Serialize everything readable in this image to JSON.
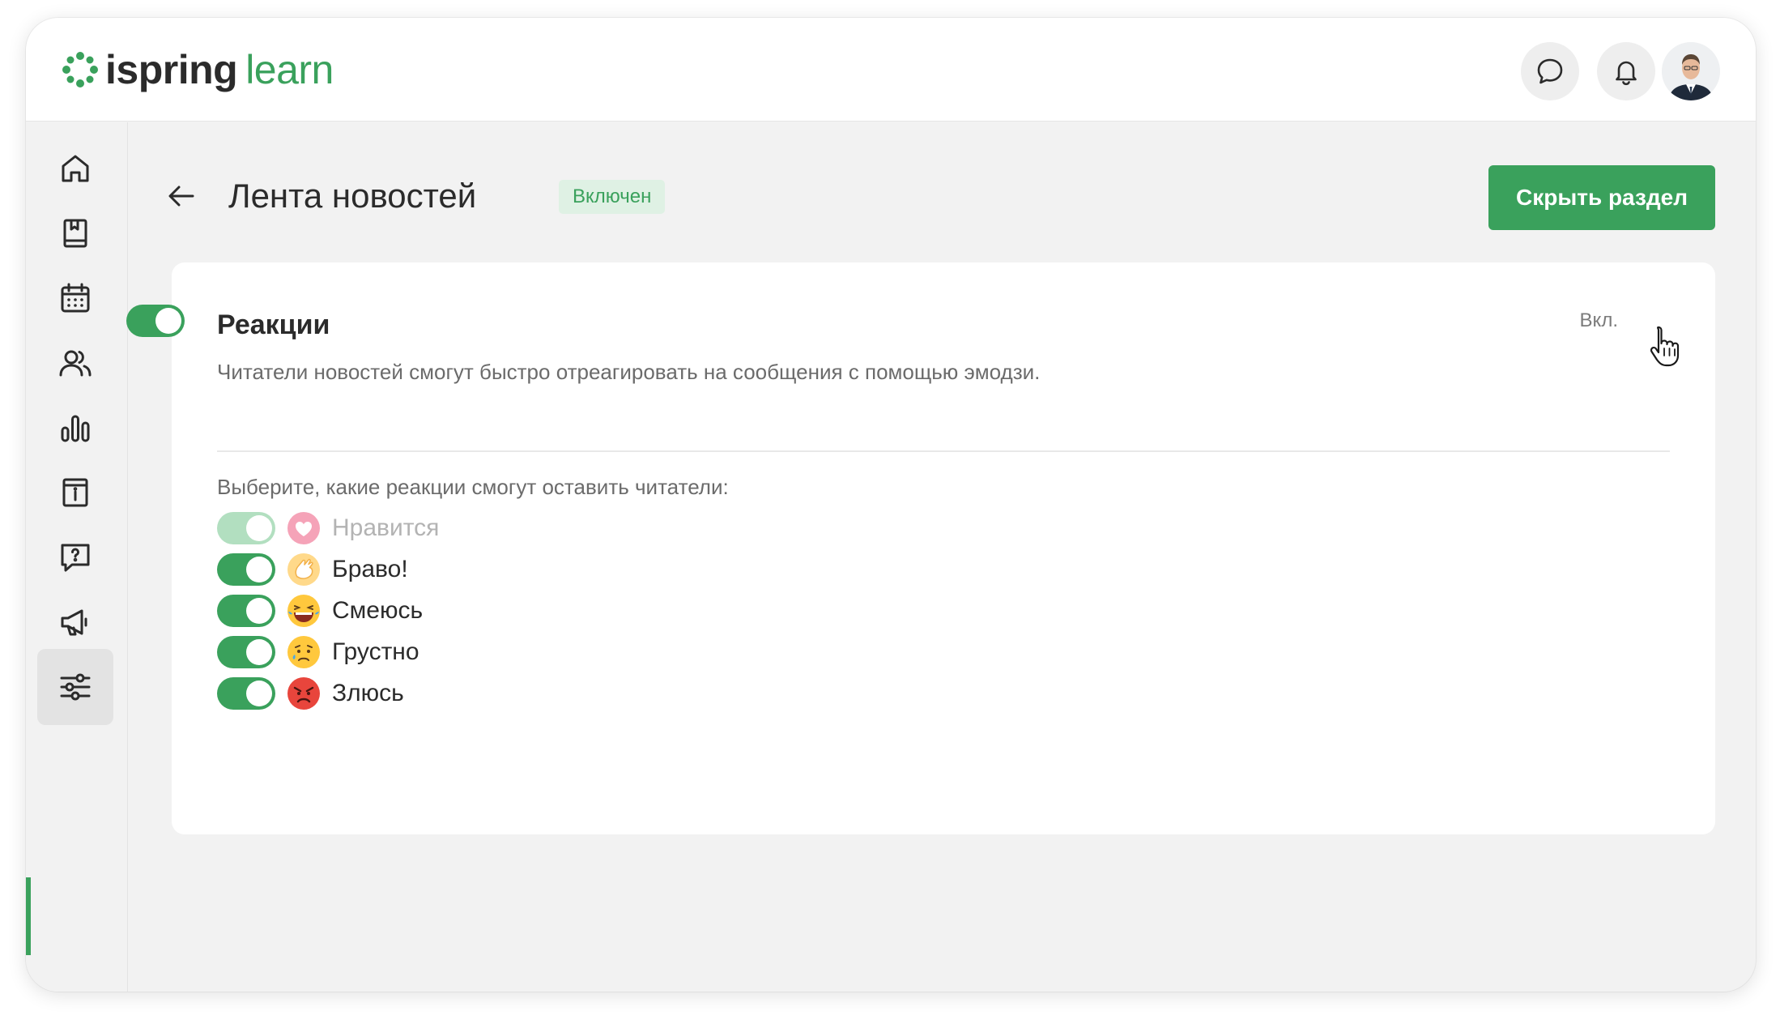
{
  "brand": {
    "name_part1": "ispring",
    "name_part2": "learn",
    "accent": "#3aa15c"
  },
  "header": {
    "icons": [
      "chat-icon",
      "bell-icon"
    ],
    "avatar": "user-avatar"
  },
  "sidebar": {
    "items": [
      {
        "icon": "home-icon",
        "active": false
      },
      {
        "icon": "book-icon",
        "active": false
      },
      {
        "icon": "calendar-icon",
        "active": false
      },
      {
        "icon": "users-icon",
        "active": false
      },
      {
        "icon": "chart-bars-icon",
        "active": false
      },
      {
        "icon": "info-card-icon",
        "active": false
      },
      {
        "icon": "question-chat-icon",
        "active": false
      },
      {
        "icon": "megaphone-icon",
        "active": false
      },
      {
        "icon": "sliders-icon",
        "active": true
      }
    ]
  },
  "page": {
    "title": "Лента новостей",
    "status_badge": "Включен",
    "hide_button": "Скрыть раздел"
  },
  "reactions_card": {
    "title": "Реакции",
    "description": "Читатели новостей смогут быстро отреагировать на сообщения с помощью эмодзи.",
    "toggle_label": "Вкл.",
    "toggle_on": true,
    "choose_label": "Выберите, какие реакции смогут оставить читатели:",
    "items": [
      {
        "label": "Нравится",
        "emoji": "heart-emoji",
        "enabled": true,
        "disabled": true
      },
      {
        "label": "Браво!",
        "emoji": "clap-emoji",
        "enabled": true,
        "disabled": false
      },
      {
        "label": "Смеюсь",
        "emoji": "laugh-emoji",
        "enabled": true,
        "disabled": false
      },
      {
        "label": "Грустно",
        "emoji": "sad-emoji",
        "enabled": true,
        "disabled": false
      },
      {
        "label": "Злюсь",
        "emoji": "angry-emoji",
        "enabled": true,
        "disabled": false
      }
    ]
  }
}
